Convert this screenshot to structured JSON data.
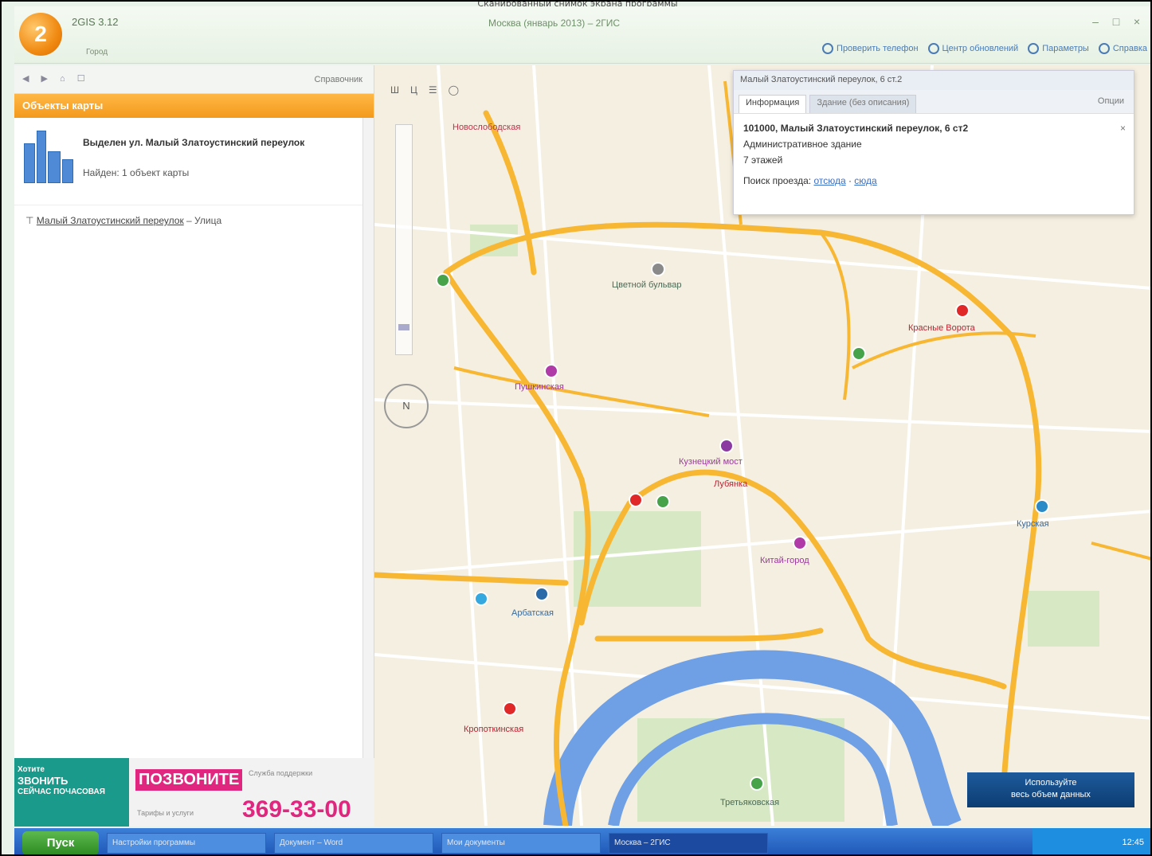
{
  "caption": "Сканированный снимок экрана программы",
  "app": {
    "name": "2GIS 3.12",
    "subtitle": "Город",
    "window_title": "Москва (январь 2013) – 2ГИС",
    "logo": "2",
    "min": "–",
    "max": "□",
    "close": "×"
  },
  "toolbar_links": [
    "Проверить телефон",
    "Центр обновлений",
    "Параметры",
    "Справка"
  ],
  "left_panel": {
    "toolbar_right": "Справочник",
    "toolbar_buttons": "◀ ▶ ⌂ ☐",
    "section_header": "Объекты карты",
    "result_title": "Выделен ул. Малый Златоустинский переулок",
    "result_found": "Найден: 1 объект карты",
    "street_name": "Малый Златоустинский переулок",
    "street_type": "– Улица"
  },
  "ads": {
    "ad1_line1": "Хотите",
    "ad1_line2": "ЗВОНИТЬ",
    "ad1_line3": "СЕЙЧАС ПОЧАСОВАЯ",
    "ad2_logo": "ПОЗВОНИТЕ",
    "ad2_phone": "369-33-00",
    "ad2_small": "Служба поддержки",
    "ad2_tiny": "Тарифы и услуги"
  },
  "info_panel": {
    "header": "Малый Златоустинский переулок, 6 ст.2",
    "tab_info": "Информация",
    "tab_other": "Здание (без описания)",
    "options": "Опции",
    "address": "101000, Малый Златоустинский переулок, 6 ст2",
    "type": "Административное здание",
    "floors": "7 этажей",
    "route_label": "Поиск проезда:",
    "route_from": "отсюда",
    "route_to": "сюда",
    "close": "×"
  },
  "map": {
    "toolbar": [
      "Ш",
      "Ц",
      "☰",
      "◯"
    ],
    "compass": "N",
    "button_line1": "Используйте",
    "button_line2": "весь объем данных",
    "labels": [
      {
        "text": "Новослободская",
        "color": "#b7374b"
      },
      {
        "text": "Цветной бульвар",
        "color": "#4a6a55"
      },
      {
        "text": "Красные Ворота",
        "color": "#c02030"
      },
      {
        "text": "Пушкинская",
        "color": "#9a3a9a"
      },
      {
        "text": "Кузнецкий мост",
        "color": "#9a3a9a"
      },
      {
        "text": "Лубянка",
        "color": "#c02030"
      },
      {
        "text": "Китай-город",
        "color": "#9a3a9a"
      },
      {
        "text": "Курская",
        "color": "#3a6a9a"
      },
      {
        "text": "Арбатская",
        "color": "#3a6a9a"
      },
      {
        "text": "Кропоткинская",
        "color": "#c02030"
      },
      {
        "text": "Третьяковская",
        "color": "#4a6a55"
      }
    ]
  },
  "taskbar": {
    "start": "Пуск",
    "tasks": [
      "Настройки программы",
      "Документ – Word",
      "Мои документы",
      "Москва – 2ГИС"
    ],
    "tray": "12:45"
  },
  "colors": {
    "accent": "#f39a1c",
    "map_bg": "#f5efe1",
    "road_major": "#f7b733",
    "river": "#6f9fe4"
  }
}
